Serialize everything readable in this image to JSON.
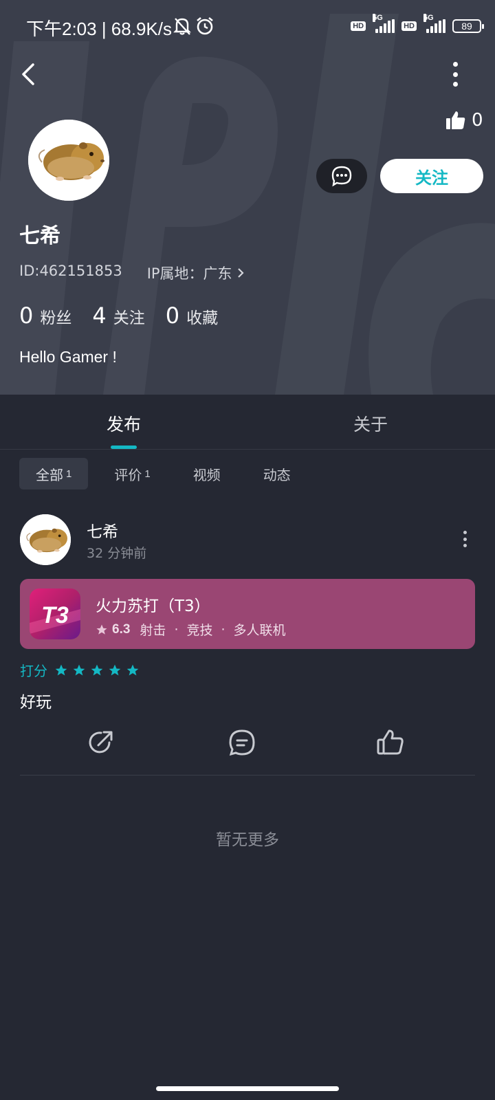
{
  "status_bar": {
    "time_speed": "下午2:03 | 68.9K/s",
    "hd1": "HD",
    "net1": "5G",
    "hd2": "HD",
    "net2": "5G",
    "battery": "89"
  },
  "profile": {
    "likes": "0",
    "follow_label": "关注",
    "name": "七希",
    "id": "ID:462151853",
    "ip": "IP属地：广东",
    "stats": [
      {
        "num": "0",
        "label": "粉丝"
      },
      {
        "num": "4",
        "label": "关注"
      },
      {
        "num": "0",
        "label": "收藏"
      }
    ],
    "bio": "Hello Gamer !"
  },
  "tabs": [
    "发布",
    "关于"
  ],
  "filters": [
    {
      "label": "全部",
      "count": "1"
    },
    {
      "label": "评价",
      "count": "1"
    },
    {
      "label": "视频",
      "count": ""
    },
    {
      "label": "动态",
      "count": ""
    }
  ],
  "post": {
    "author": "七希",
    "time": "32 分钟前",
    "game": {
      "name": "火力苏打（T3）",
      "icon_text": "T3",
      "score": "6.3",
      "tags": [
        "射击",
        "竞技",
        "多人联机"
      ]
    },
    "rating_label": "打分",
    "stars": 5,
    "review": "好玩"
  },
  "no_more": "暂无更多",
  "colors": {
    "accent": "#14b8c4",
    "header_bg": "#3a3e4b",
    "page_bg": "#252833",
    "game_card": "#9a4673"
  }
}
